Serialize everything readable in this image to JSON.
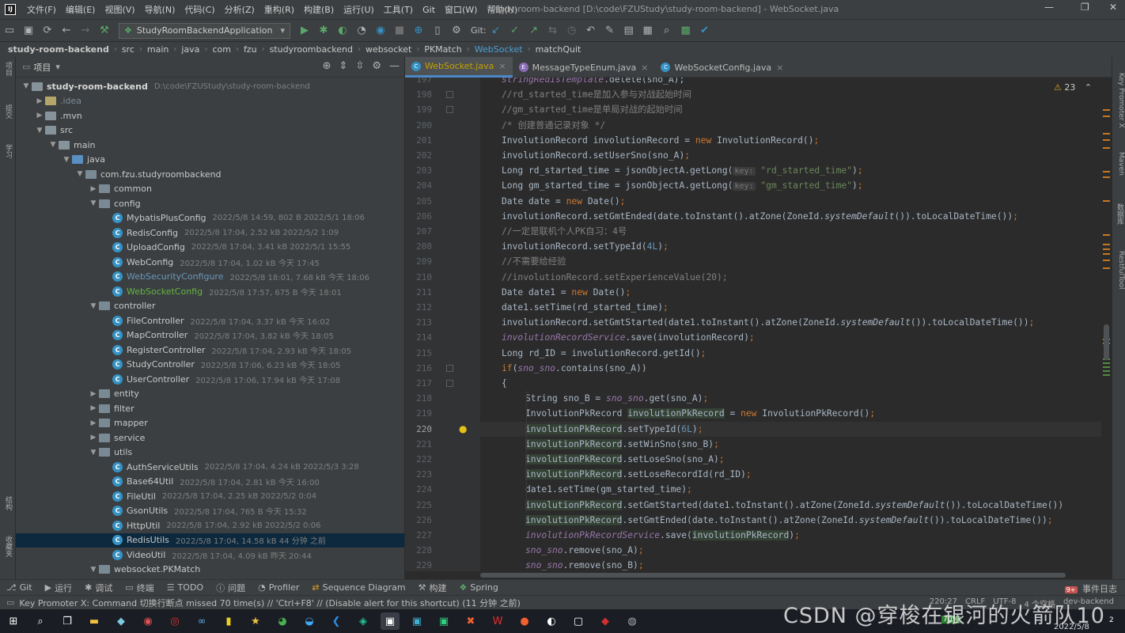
{
  "app": {
    "logo": "IJ",
    "window_title": "study-room-backend [D:\\code\\FZUStudy\\study-room-backend] - WebSocket.java",
    "menu": [
      "文件(F)",
      "编辑(E)",
      "视图(V)",
      "导航(N)",
      "代码(C)",
      "分析(Z)",
      "重构(R)",
      "构建(B)",
      "运行(U)",
      "工具(T)",
      "Git",
      "窗口(W)",
      "帮助(H)"
    ],
    "window_controls": {
      "minimize": "—",
      "maximize": "❐",
      "close": "✕"
    }
  },
  "toolbar": {
    "run_config": "StudyRoomBackendApplication",
    "git_label": "Git:"
  },
  "breadcrumb": [
    "study-room-backend",
    "src",
    "main",
    "java",
    "com",
    "fzu",
    "studyroombackend",
    "websocket",
    "PKMatch",
    "WebSocket",
    "matchQuit"
  ],
  "left_strip": {
    "labels": [
      "项目",
      "提交",
      "学习",
      "结构",
      "收藏夹"
    ]
  },
  "right_strip": {
    "labels": [
      "Key Promoter X",
      "Maven",
      "数据库",
      "RestfulTool"
    ]
  },
  "project": {
    "header": "项目",
    "tree": [
      {
        "depth": 0,
        "open": true,
        "kind": "root",
        "name": "study-room-backend",
        "meta": "D:\\code\\FZUStudy\\study-room-backend",
        "style": "bold"
      },
      {
        "depth": 1,
        "open": false,
        "kind": "idea",
        "name": ".idea",
        "style": "idea"
      },
      {
        "depth": 1,
        "open": false,
        "kind": "folder",
        "name": ".mvn"
      },
      {
        "depth": 1,
        "open": true,
        "kind": "folder",
        "name": "src"
      },
      {
        "depth": 2,
        "open": true,
        "kind": "folder",
        "name": "main"
      },
      {
        "depth": 3,
        "open": true,
        "kind": "src",
        "name": "java"
      },
      {
        "depth": 4,
        "open": true,
        "kind": "pkg",
        "name": "com.fzu.studyroombackend"
      },
      {
        "depth": 5,
        "open": false,
        "kind": "pkg",
        "name": "common"
      },
      {
        "depth": 5,
        "open": true,
        "kind": "pkg",
        "name": "config"
      },
      {
        "depth": 6,
        "kind": "class",
        "name": "MybatisPlusConfig",
        "meta": "2022/5/8 14:59, 802 B 2022/5/1 18:06"
      },
      {
        "depth": 6,
        "kind": "class",
        "name": "RedisConfig",
        "meta": "2022/5/8 17:04, 2.52 kB 2022/5/2 1:09"
      },
      {
        "depth": 6,
        "kind": "class",
        "name": "UploadConfig",
        "meta": "2022/5/8 17:04, 3.41 kB 2022/5/1 15:55"
      },
      {
        "depth": 6,
        "kind": "class",
        "name": "WebConfig",
        "meta": "2022/5/8 17:04, 1.02 kB 今天 17:45"
      },
      {
        "depth": 6,
        "kind": "class",
        "name": "WebSecurityConfigure",
        "meta": "2022/5/8 18:01, 7.68 kB 今天 18:06",
        "style": "blue"
      },
      {
        "depth": 6,
        "kind": "class",
        "name": "WebSocketConfig",
        "meta": "2022/5/8 17:57, 675 B 今天 18:01",
        "style": "green"
      },
      {
        "depth": 5,
        "open": true,
        "kind": "pkg",
        "name": "controller"
      },
      {
        "depth": 6,
        "kind": "class",
        "name": "FileController",
        "meta": "2022/5/8 17:04, 3.37 kB 今天 16:02"
      },
      {
        "depth": 6,
        "kind": "class",
        "name": "MapController",
        "meta": "2022/5/8 17:04, 3.82 kB 今天 18:05"
      },
      {
        "depth": 6,
        "kind": "class",
        "name": "RegisterController",
        "meta": "2022/5/8 17:04, 2.93 kB 今天 18:05"
      },
      {
        "depth": 6,
        "kind": "class",
        "name": "StudyController",
        "meta": "2022/5/8 17:06, 6.23 kB 今天 18:05"
      },
      {
        "depth": 6,
        "kind": "class",
        "name": "UserController",
        "meta": "2022/5/8 17:06, 17.94 kB 今天 17:08"
      },
      {
        "depth": 5,
        "open": false,
        "kind": "pkg",
        "name": "entity"
      },
      {
        "depth": 5,
        "open": false,
        "kind": "pkg",
        "name": "filter"
      },
      {
        "depth": 5,
        "open": false,
        "kind": "pkg",
        "name": "mapper"
      },
      {
        "depth": 5,
        "open": false,
        "kind": "pkg",
        "name": "service"
      },
      {
        "depth": 5,
        "open": true,
        "kind": "pkg",
        "name": "utils"
      },
      {
        "depth": 6,
        "kind": "class",
        "name": "AuthServiceUtils",
        "meta": "2022/5/8 17:04, 4.24 kB 2022/5/3 3:28"
      },
      {
        "depth": 6,
        "kind": "class",
        "name": "Base64Util",
        "meta": "2022/5/8 17:04, 2.81 kB 今天 16:00"
      },
      {
        "depth": 6,
        "kind": "class",
        "name": "FileUtil",
        "meta": "2022/5/8 17:04, 2.25 kB 2022/5/2 0:04"
      },
      {
        "depth": 6,
        "kind": "class",
        "name": "GsonUtils",
        "meta": "2022/5/8 17:04, 765 B 今天 15:32"
      },
      {
        "depth": 6,
        "kind": "class",
        "name": "HttpUtil",
        "meta": "2022/5/8 17:04, 2.92 kB 2022/5/2 0:06"
      },
      {
        "depth": 6,
        "kind": "class",
        "name": "RedisUtils",
        "meta": "2022/5/8 17:04, 14.58 kB 44 分钟 之前",
        "selected": true
      },
      {
        "depth": 6,
        "kind": "class",
        "name": "VideoUtil",
        "meta": "2022/5/8 17:04, 4.09 kB 昨天 20:44"
      },
      {
        "depth": 5,
        "open": true,
        "kind": "pkg",
        "name": "websocket.PKMatch"
      }
    ]
  },
  "editor": {
    "tabs": [
      {
        "name": "WebSocket.java",
        "active": true,
        "kind": "class"
      },
      {
        "name": "MessageTypeEnum.java",
        "active": false,
        "kind": "enum"
      },
      {
        "name": "WebSocketConfig.java",
        "active": false,
        "kind": "class"
      }
    ],
    "warnings": "23",
    "current_line": 220,
    "lines": [
      {
        "n": 197,
        "i": 0,
        "h": "<span class='fld'>stringRedisTemplate</span>.delete(sno_A);"
      },
      {
        "n": 198,
        "i": 0,
        "h": "<span class='cm'>//rd_started_time是加入参与对战起始时间</span>"
      },
      {
        "n": 199,
        "i": 0,
        "h": "<span class='cm'>//gm_started_time是单局对战的起始时间</span>"
      },
      {
        "n": 200,
        "i": 0,
        "h": "<span class='cm'>/* 创建普通记录对象 */</span>"
      },
      {
        "n": 201,
        "i": 0,
        "h": "InvolutionRecord involutionRecord = <span class='kw'>new</span> InvolutionRecord()<span class='kw'>;</span>"
      },
      {
        "n": 202,
        "i": 0,
        "h": "involutionRecord.setUserSno(sno_A)<span class='kw'>;</span>"
      },
      {
        "n": 203,
        "i": 0,
        "h": "Long rd_started_time = jsonObjectA.getLong(<span class='hint'>key:</span> <span class='str'>\"rd_started_time\"</span>)<span class='kw'>;</span>"
      },
      {
        "n": 204,
        "i": 0,
        "h": "Long gm_started_time = jsonObjectA.getLong(<span class='hint'>key:</span> <span class='str'>\"gm_started_time\"</span>)<span class='kw'>;</span>"
      },
      {
        "n": 205,
        "i": 0,
        "h": "Date date = <span class='kw'>new</span> Date()<span class='kw'>;</span>"
      },
      {
        "n": 206,
        "i": 0,
        "h": "involutionRecord.setGmtEnded(date.toInstant().atZone(ZoneId.<span class='it'>systemDefault</span>()).toLocalDateTime())<span class='kw'>;</span>"
      },
      {
        "n": 207,
        "i": 0,
        "h": "<span class='cm'>//一定是联机个人PK自习：4号</span>"
      },
      {
        "n": 208,
        "i": 0,
        "h": "involutionRecord.setTypeId(<span class='num'>4L</span>)<span class='kw'>;</span>"
      },
      {
        "n": 209,
        "i": 0,
        "h": "<span class='cm'>//不需要给经验</span>"
      },
      {
        "n": 210,
        "i": 0,
        "h": "<span class='cm'>//involutionRecord.setExperienceValue(20);</span>"
      },
      {
        "n": 211,
        "i": 0,
        "h": "Date date1 = <span class='kw'>new</span> Date()<span class='kw'>;</span>"
      },
      {
        "n": 212,
        "i": 0,
        "h": "date1.setTime(rd_started_time)<span class='kw'>;</span>"
      },
      {
        "n": 213,
        "i": 0,
        "h": "involutionRecord.setGmtStarted(date1.toInstant().atZone(ZoneId.<span class='it'>systemDefault</span>()).toLocalDateTime())<span class='kw'>;</span>"
      },
      {
        "n": 214,
        "i": 0,
        "h": "<span class='fld'>involutionRecordService</span>.save(involutionRecord)<span class='kw'>;</span>"
      },
      {
        "n": 215,
        "i": 0,
        "h": "Long rd_ID = involutionRecord.getId()<span class='kw'>;</span>"
      },
      {
        "n": 216,
        "i": 0,
        "h": "<span class='kw'>if</span>(<span class='fld'>sno_sno</span>.contains(sno_A))"
      },
      {
        "n": 217,
        "i": 0,
        "h": "{"
      },
      {
        "n": 218,
        "i": 1,
        "h": "String sno_B = <span class='fld'>sno_sno</span>.get(sno_A)<span class='kw'>;</span>"
      },
      {
        "n": 219,
        "i": 1,
        "h": "InvolutionPkRecord <span class='hl'>involutionPkRecord</span> = <span class='kw'>new</span> InvolutionPkRecord()<span class='kw'>;</span>"
      },
      {
        "n": 220,
        "i": 1,
        "h": "<span class='hl'>involutionPkRecord</span>.setTypeId(<span class='num'>6L</span>)<span class='kw'>;</span>"
      },
      {
        "n": 221,
        "i": 1,
        "h": "<span class='hl'>involutionPkRecord</span>.setWinSno(sno_B)<span class='kw'>;</span>"
      },
      {
        "n": 222,
        "i": 1,
        "h": "<span class='hl'>involutionPkRecord</span>.setLoseSno(sno_A)<span class='kw'>;</span>"
      },
      {
        "n": 223,
        "i": 1,
        "h": "<span class='hl'>involutionPkRecord</span>.setLoseRecordId(rd_ID)<span class='kw'>;</span>"
      },
      {
        "n": 224,
        "i": 1,
        "h": "date1.setTime(gm_started_time)<span class='kw'>;</span>"
      },
      {
        "n": 225,
        "i": 1,
        "h": "<span class='hl'>involutionPkRecord</span>.setGmtStarted(date1.toInstant().atZone(ZoneId.<span class='it'>systemDefault</span>()).toLocalDateTime())"
      },
      {
        "n": 226,
        "i": 1,
        "h": "<span class='hl'>involutionPkRecord</span>.setGmtEnded(date.toInstant().atZone(ZoneId.<span class='it'>systemDefault</span>()).toLocalDateTime())<span class='kw'>;</span>"
      },
      {
        "n": 227,
        "i": 1,
        "h": "<span class='fld'>involutionPkRecordService</span>.save(<span class='hl'>involutionPkRecord</span>)<span class='kw'>;</span>"
      },
      {
        "n": 228,
        "i": 1,
        "h": "<span class='fld'>sno_sno</span>.remove(sno_A)<span class='kw'>;</span>"
      },
      {
        "n": 229,
        "i": 1,
        "h": "<span class='fld'>sno_sno</span>.remove(sno_B)<span class='kw'>;</span>"
      }
    ]
  },
  "toolwindows": [
    "Git",
    "运行",
    "调试",
    "终端",
    "TODO",
    "问题",
    "Profiler",
    "Sequence Diagram",
    "构建",
    "Spring"
  ],
  "event_log": {
    "badge": "9+",
    "label": "事件日志"
  },
  "status": {
    "message": "Key Promoter X: Command 切换行断点 missed 70 time(s) // 'Ctrl+F8' // (Disable alert for this shortcut) (11 分钟 之前)",
    "position": "220:27",
    "line_sep": "CRLF",
    "encoding": "UTF-8",
    "indent": "4 个空格",
    "branch": "dev-backend"
  },
  "taskbar": {
    "battery": "70%",
    "date": "2022/5/8",
    "notifications": "2"
  },
  "watermark": "CSDN @穿梭在银河的火箭队10"
}
